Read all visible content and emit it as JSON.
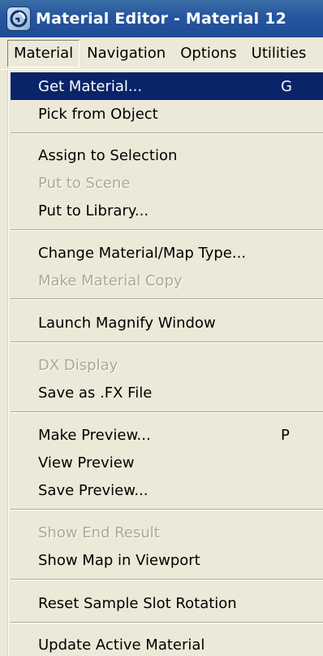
{
  "window": {
    "title": "Material Editor - Material 12",
    "icon": "3ds-max-logo-icon"
  },
  "menubar": {
    "items": [
      "Material",
      "Navigation",
      "Options",
      "Utilities"
    ],
    "open_item": "Material"
  },
  "menu": {
    "items": [
      {
        "label": "Get Material...",
        "shortcut": "G",
        "state": "highlighted"
      },
      {
        "label": "Pick from Object",
        "shortcut": "",
        "state": "enabled"
      },
      {
        "label": "Assign to Selection",
        "shortcut": "",
        "state": "enabled"
      },
      {
        "label": "Put to Scene",
        "shortcut": "",
        "state": "disabled"
      },
      {
        "label": "Put to Library...",
        "shortcut": "",
        "state": "enabled"
      },
      {
        "label": "Change Material/Map Type...",
        "shortcut": "",
        "state": "enabled"
      },
      {
        "label": "Make Material Copy",
        "shortcut": "",
        "state": "disabled"
      },
      {
        "label": "Launch Magnify Window",
        "shortcut": "",
        "state": "enabled"
      },
      {
        "label": "DX Display",
        "shortcut": "",
        "state": "disabled"
      },
      {
        "label": "Save as .FX File",
        "shortcut": "",
        "state": "enabled"
      },
      {
        "label": "Make Preview...",
        "shortcut": "P",
        "state": "enabled"
      },
      {
        "label": "View Preview",
        "shortcut": "",
        "state": "enabled"
      },
      {
        "label": "Save Preview...",
        "shortcut": "",
        "state": "enabled"
      },
      {
        "label": "Show End Result",
        "shortcut": "",
        "state": "disabled"
      },
      {
        "label": "Show Map in Viewport",
        "shortcut": "",
        "state": "enabled"
      },
      {
        "label": "Reset Sample Slot Rotation",
        "shortcut": "",
        "state": "enabled"
      },
      {
        "label": "Update Active Material",
        "shortcut": "",
        "state": "enabled"
      }
    ]
  },
  "colors": {
    "titlebar": "#2857a0",
    "highlight": "#0a246a",
    "menu_bg": "#ece9d8",
    "disabled_text": "#aca899"
  }
}
